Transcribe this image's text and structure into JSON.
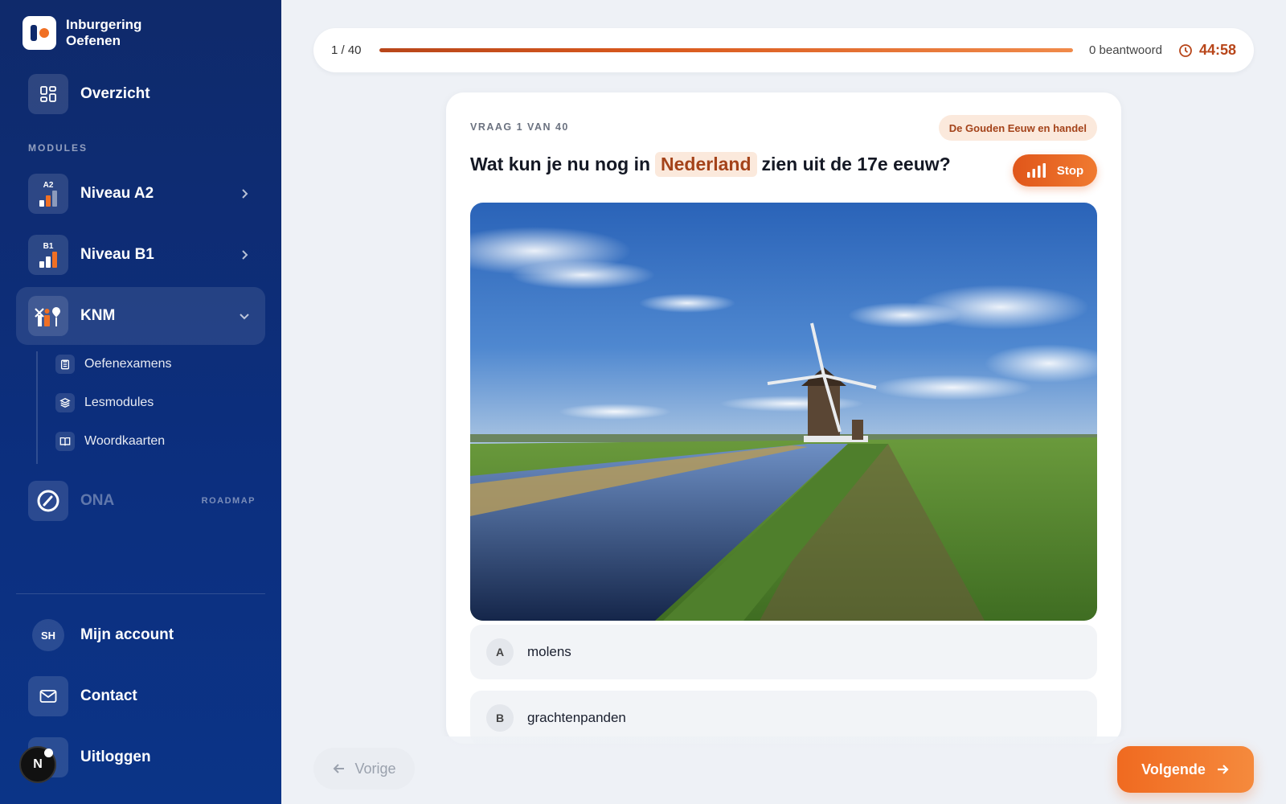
{
  "sidebar": {
    "brand": {
      "line1": "Inburgering",
      "line2": "Oefenen"
    },
    "overview_label": "Overzicht",
    "section_label": "MODULES",
    "modules": [
      {
        "label": "Niveau A2",
        "badge": "A2"
      },
      {
        "label": "Niveau B1",
        "badge": "B1"
      },
      {
        "label": "KNM"
      },
      {
        "label": "ONA",
        "tag": "ROADMAP"
      }
    ],
    "knm_sub": [
      {
        "label": "Oefenexamens"
      },
      {
        "label": "Lesmodules"
      },
      {
        "label": "Woordkaarten"
      }
    ],
    "account": {
      "initials": "SH",
      "label": "Mijn account"
    },
    "contact_label": "Contact",
    "logout_label": "Uitloggen",
    "n_badge": "N"
  },
  "topbar": {
    "progress_text": "1 / 40",
    "progress_fraction": 1.0,
    "answered_text": "0 beantwoord",
    "timer": "44:58"
  },
  "question": {
    "meta": "VRAAG 1 VAN 40",
    "topic": "De Gouden Eeuw en handel",
    "text_before": "Wat kun je nu nog in",
    "highlight": "Nederland",
    "text_after": "zien uit de 17e eeuw?",
    "stop_label": "Stop",
    "options": [
      {
        "letter": "A",
        "text": "molens"
      },
      {
        "letter": "B",
        "text": "grachtenpanden"
      }
    ]
  },
  "nav": {
    "prev_label": "Vorige",
    "next_label": "Volgende"
  },
  "colors": {
    "sidebar": "#0f2a6b",
    "accent": "#f07024",
    "accent_dark": "#b8461a"
  }
}
